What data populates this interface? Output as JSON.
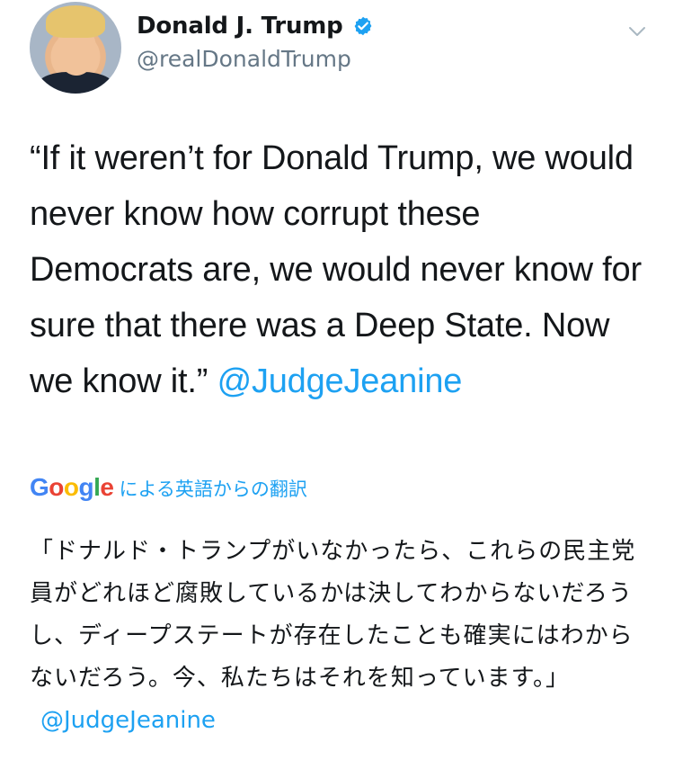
{
  "tweet": {
    "author": {
      "name": "Donald J. Trump",
      "handle": "@realDonaldTrump",
      "verified": true
    },
    "text": "“If it weren’t for Donald Trump, we would never know how corrupt these Democrats are, we would never know for sure that there was a Deep State. Now we know it.”",
    "mention": "@JudgeJeanine",
    "translation": {
      "provider": "Google",
      "label": "による英語からの翻訳",
      "text": "「ドナルド・トランプがいなかったら、これらの民主党員がどれほど腐敗しているかは決してわからないだろうし、ディープステートが存在したことも確実にはわからないだろう。今、私たちはそれを知っています。」",
      "mention": "@JudgeJeanine"
    }
  },
  "colors": {
    "text": "#14171a",
    "secondary": "#657786",
    "link": "#1da1f2",
    "verified": "#1da1f2"
  },
  "icons": {
    "verified": "verified-badge-icon",
    "more": "chevron-down-icon",
    "avatar": "profile-avatar"
  }
}
